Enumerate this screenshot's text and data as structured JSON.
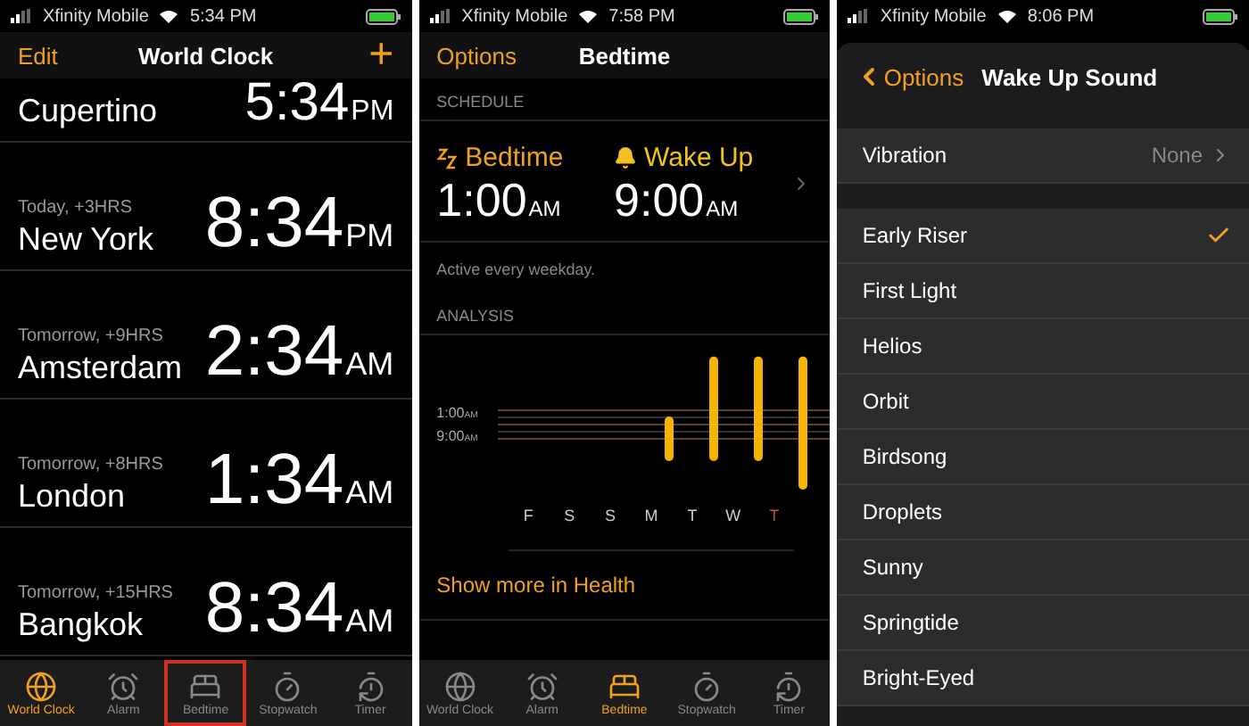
{
  "screens": [
    {
      "kind": "world_clock",
      "status_bar": {
        "carrier": "Xfinity Mobile",
        "time": "5:34 PM"
      },
      "nav": {
        "left": "Edit",
        "title": "World Clock",
        "right": "+"
      },
      "clocks": [
        {
          "city": "Cupertino",
          "time": "5:34",
          "period": "PM"
        },
        {
          "offset": "Today, +3HRS",
          "city": "New York",
          "time": "8:34",
          "period": "PM"
        },
        {
          "offset": "Tomorrow, +9HRS",
          "city": "Amsterdam",
          "time": "2:34",
          "period": "AM"
        },
        {
          "offset": "Tomorrow, +8HRS",
          "city": "London",
          "time": "1:34",
          "period": "AM"
        },
        {
          "offset": "Tomorrow, +15HRS",
          "city": "Bangkok",
          "time": "8:34",
          "period": "AM"
        }
      ],
      "tabs": [
        {
          "kind": "globe",
          "label": "World Clock",
          "selected": true,
          "highlighted": false
        },
        {
          "kind": "alarm",
          "label": "Alarm",
          "selected": false,
          "highlighted": false
        },
        {
          "kind": "bed",
          "label": "Bedtime",
          "selected": false,
          "highlighted": true
        },
        {
          "kind": "stopwatch",
          "label": "Stopwatch",
          "selected": false,
          "highlighted": false
        },
        {
          "kind": "timer",
          "label": "Timer",
          "selected": false,
          "highlighted": false
        }
      ]
    },
    {
      "kind": "bedtime",
      "status_bar": {
        "carrier": "Xfinity Mobile",
        "time": "7:58 PM"
      },
      "nav": {
        "left": "Options",
        "title": "Bedtime"
      },
      "schedule": {
        "header": "SCHEDULE",
        "bedtime": {
          "label": "Bedtime",
          "time": "1:00",
          "period": "AM"
        },
        "wake": {
          "label": "Wake Up",
          "time": "9:00",
          "period": "AM"
        },
        "note": "Active every weekday."
      },
      "analysis": {
        "header": "ANALYSIS",
        "lines": [
          {
            "time": "1:00",
            "period": "AM"
          },
          {
            "time": "9:00",
            "period": "AM"
          }
        ],
        "days": [
          {
            "label": "F",
            "today": false
          },
          {
            "label": "S",
            "today": false
          },
          {
            "label": "S",
            "today": false
          },
          {
            "label": "M",
            "today": false
          },
          {
            "label": "T",
            "today": false
          },
          {
            "label": "W",
            "today": false
          },
          {
            "label": "T",
            "today": true
          }
        ]
      },
      "link": "Show more in Health",
      "tabs": [
        {
          "kind": "globe",
          "label": "World Clock",
          "selected": false,
          "highlighted": false
        },
        {
          "kind": "alarm",
          "label": "Alarm",
          "selected": false,
          "highlighted": false
        },
        {
          "kind": "bed",
          "label": "Bedtime",
          "selected": true,
          "highlighted": false
        },
        {
          "kind": "stopwatch",
          "label": "Stopwatch",
          "selected": false,
          "highlighted": false
        },
        {
          "kind": "timer",
          "label": "Timer",
          "selected": false,
          "highlighted": false
        }
      ]
    },
    {
      "kind": "sound",
      "status_bar": {
        "carrier": "Xfinity Mobile",
        "time": "8:06 PM"
      },
      "nav": {
        "left": "Options",
        "title": "Wake Up Sound"
      },
      "vibration": {
        "label": "Vibration",
        "value": "None"
      },
      "sounds": [
        {
          "name": "Early Riser",
          "checked": true
        },
        {
          "name": "First Light",
          "checked": false
        },
        {
          "name": "Helios",
          "checked": false
        },
        {
          "name": "Orbit",
          "checked": false
        },
        {
          "name": "Birdsong",
          "checked": false
        },
        {
          "name": "Droplets",
          "checked": false
        },
        {
          "name": "Sunny",
          "checked": false
        },
        {
          "name": "Springtide",
          "checked": false
        },
        {
          "name": "Bright-Eyed",
          "checked": false
        }
      ]
    }
  ]
}
